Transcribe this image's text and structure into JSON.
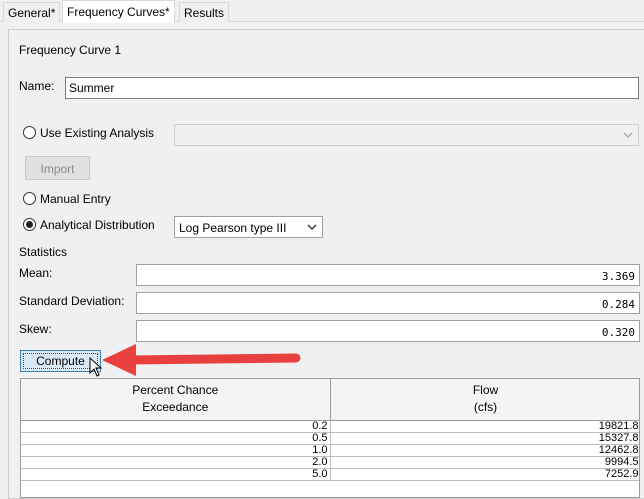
{
  "tabs": [
    {
      "label": "General*",
      "active": false
    },
    {
      "label": "Frequency Curves*",
      "active": true
    },
    {
      "label": "Results",
      "active": false
    }
  ],
  "panel": {
    "title": "Frequency Curve 1",
    "name_label": "Name:",
    "name_value": "Summer",
    "use_existing_label": "Use Existing Analysis",
    "use_existing_selected": false,
    "existing_analysis_value": "",
    "import_label": "Import",
    "manual_entry_label": "Manual Entry",
    "manual_entry_selected": false,
    "analytical_label": "Analytical Distribution",
    "analytical_selected": true,
    "distribution_value": "Log Pearson type III"
  },
  "statistics": {
    "heading": "Statistics",
    "mean_label": "Mean:",
    "mean_value": "3.369",
    "stddev_label": "Standard Deviation:",
    "stddev_value": "0.284",
    "skew_label": "Skew:",
    "skew_value": "0.320"
  },
  "compute_label": "Compute",
  "table": {
    "col1_line1": "Percent Chance",
    "col1_line2": "Exceedance",
    "col2_line1": "Flow",
    "col2_line2": "(cfs)",
    "rows": [
      {
        "pce": "0.2",
        "flow": "19821.8"
      },
      {
        "pce": "0.5",
        "flow": "15327.8"
      },
      {
        "pce": "1.0",
        "flow": "12462.8"
      },
      {
        "pce": "2.0",
        "flow": "9994.5"
      },
      {
        "pce": "5.0",
        "flow": "7252.9"
      }
    ]
  },
  "colors": {
    "arrow": "#e8403f",
    "button_bg": "#dbe9f7",
    "button_border": "#3c7fb1"
  }
}
